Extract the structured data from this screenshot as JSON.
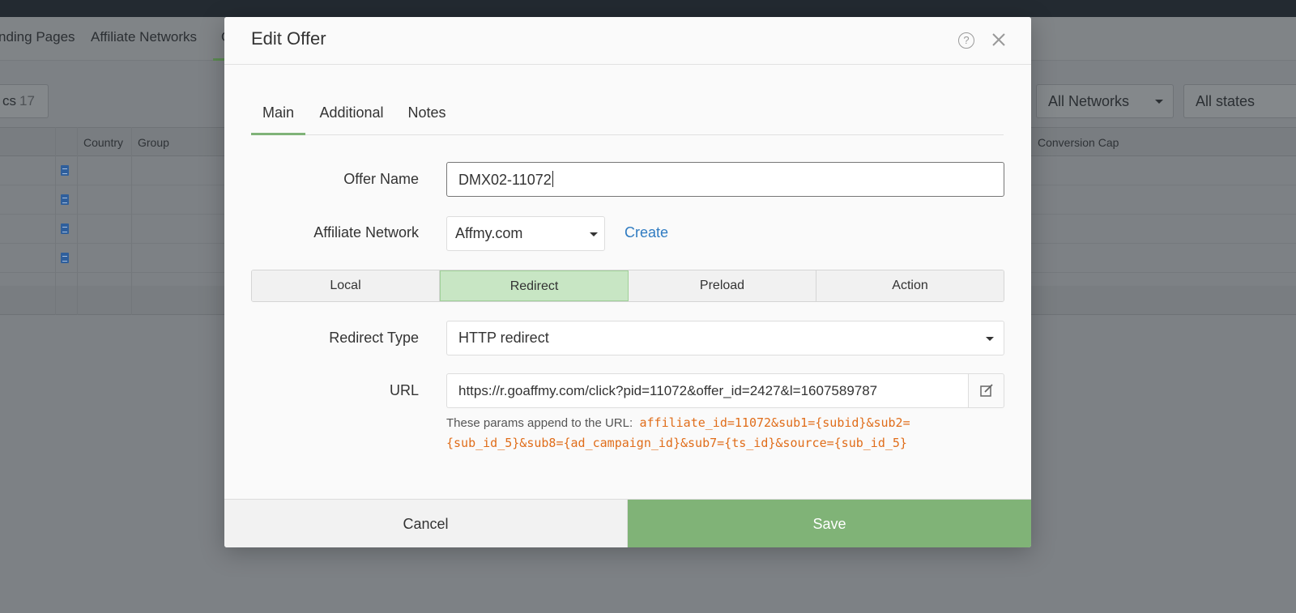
{
  "background": {
    "nav_items": [
      "nding Pages",
      "Affiliate Networks",
      "O"
    ],
    "chip": {
      "label": "cs",
      "count": "17"
    },
    "network_filter": "All Networks",
    "state_filter": "All states",
    "columns": {
      "country": "Country",
      "group": "Group",
      "conversion_cap": "Conversion Cap"
    }
  },
  "modal": {
    "title": "Edit Offer",
    "help_icon": "?",
    "tabs": [
      {
        "label": "Main",
        "active": true
      },
      {
        "label": "Additional",
        "active": false
      },
      {
        "label": "Notes",
        "active": false
      }
    ],
    "offer_name": {
      "label": "Offer Name",
      "value": "DMX02-11072"
    },
    "affiliate_network": {
      "label": "Affiliate Network",
      "value": "Affmy.com",
      "create_label": "Create"
    },
    "modes": [
      {
        "label": "Local",
        "active": false
      },
      {
        "label": "Redirect",
        "active": true
      },
      {
        "label": "Preload",
        "active": false
      },
      {
        "label": "Action",
        "active": false
      }
    ],
    "redirect_type": {
      "label": "Redirect Type",
      "value": "HTTP redirect"
    },
    "url": {
      "label": "URL",
      "value": "https://r.goaffmy.com/click?pid=11072&offer_id=2427&l=1607589787",
      "params_prefix": "These params append to the URL:",
      "params_line1": "affiliate_id=11072&sub1={subid}&sub2=",
      "params_line2": "{sub_id_5}&sub8={ad_campaign_id}&sub7={ts_id}&source={sub_id_5}"
    },
    "footer": {
      "cancel_label": "Cancel",
      "save_label": "Save"
    }
  },
  "colors": {
    "accent_green": "#80b377",
    "active_segment": "#c8e6c4",
    "link_blue": "#2f7bc1",
    "params_orange": "#e06d1a"
  }
}
